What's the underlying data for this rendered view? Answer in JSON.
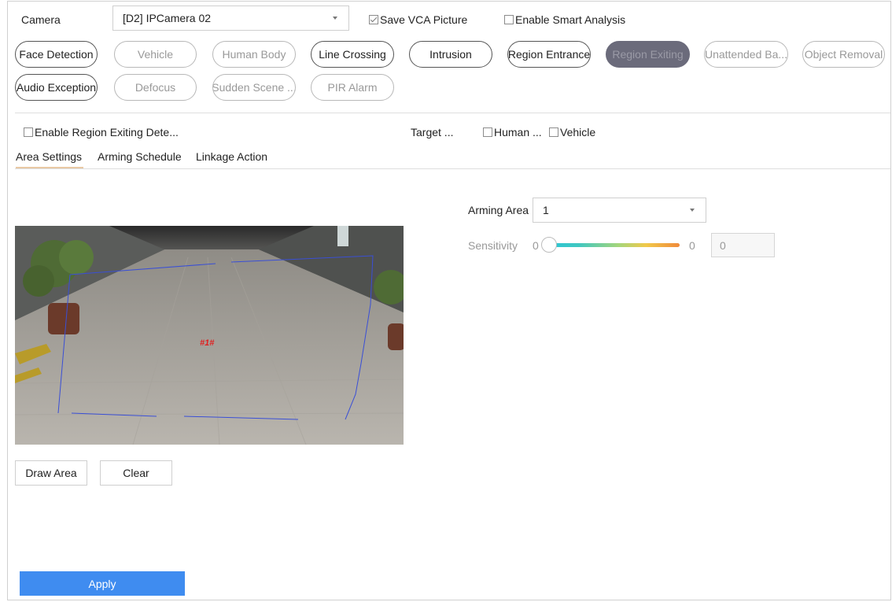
{
  "camera": {
    "label": "Camera",
    "selected": "[D2] IPCamera 02",
    "save_vca_label": "Save VCA Picture",
    "save_vca_checked": true,
    "smart_analysis_label": "Enable Smart Analysis",
    "smart_analysis_checked": false
  },
  "detection_types": [
    {
      "label": "Face Detection",
      "state": "normal"
    },
    {
      "label": "Vehicle",
      "state": "disabled"
    },
    {
      "label": "Human Body",
      "state": "disabled"
    },
    {
      "label": "Line Crossing",
      "state": "normal"
    },
    {
      "label": "Intrusion",
      "state": "normal"
    },
    {
      "label": "Region Entrance",
      "state": "normal"
    },
    {
      "label": "Region Exiting",
      "state": "active"
    },
    {
      "label": "Unattended Ba...",
      "state": "disabled"
    },
    {
      "label": "Object Removal",
      "state": "disabled"
    },
    {
      "label": "Audio Exception",
      "state": "normal"
    },
    {
      "label": "Defocus",
      "state": "disabled"
    },
    {
      "label": "Sudden Scene ...",
      "state": "disabled"
    },
    {
      "label": "PIR Alarm",
      "state": "disabled"
    }
  ],
  "enable": {
    "label": "Enable Region Exiting Dete...",
    "checked": false
  },
  "target": {
    "label": "Target ...",
    "human_label": "Human ...",
    "human_checked": false,
    "vehicle_label": "Vehicle",
    "vehicle_checked": false
  },
  "tabs": [
    {
      "label": "Area Settings",
      "active": true
    },
    {
      "label": "Arming Schedule",
      "active": false
    },
    {
      "label": "Linkage Action",
      "active": false
    }
  ],
  "video": {
    "region_label": "#1#"
  },
  "area": {
    "draw_label": "Draw Area",
    "clear_label": "Clear"
  },
  "arming_area": {
    "label": "Arming Area",
    "value": "1"
  },
  "sensitivity": {
    "label": "Sensitivity",
    "min": "0",
    "max": "0",
    "value": "0"
  },
  "apply_label": "Apply",
  "colors": {
    "accent": "#3f8cf0",
    "active_pill": "#6b6b7b",
    "region_line": "#3a4fd6",
    "region_label": "#e02020"
  }
}
